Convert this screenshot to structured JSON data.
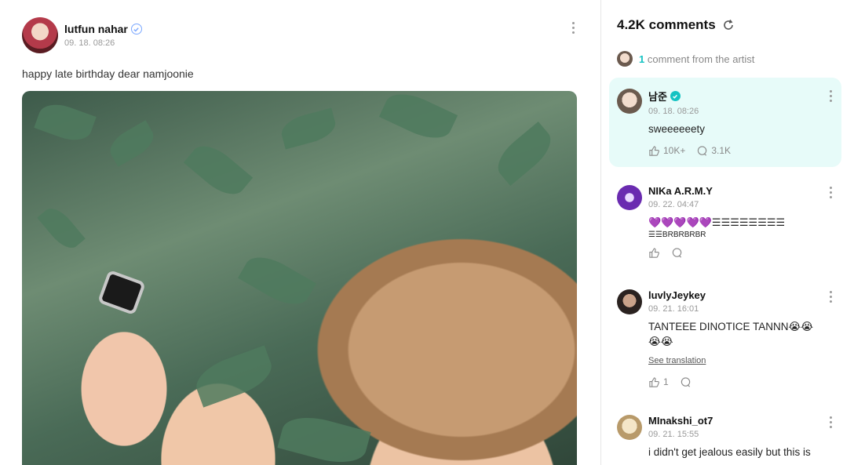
{
  "post": {
    "author": "lutfun nahar",
    "timestamp": "09. 18. 08:26",
    "text": "happy late birthday dear namjoonie"
  },
  "comments_panel": {
    "count_label": "4.2K comments",
    "artist_count": "1",
    "artist_label": "comment from the artist",
    "items": [
      {
        "name": "남준",
        "time": "09. 18. 08:26",
        "text": "sweeeeeety",
        "likes": "10K+",
        "replies": "3.1K"
      },
      {
        "name": "NIKa A.R.M.Y",
        "time": "09. 22. 04:47",
        "text_line1": "💜💜💜💜💜☰☰☰☰☰☰☰☰",
        "text_line2": "☰☰BRBRBRBR",
        "likes": "",
        "replies": ""
      },
      {
        "name": "luvlyJeykey",
        "time": "09. 21. 16:01",
        "text": "TANTEEE DINOTICE TANNN😭😭 😭😭",
        "see_translation": "See translation",
        "likes": "1",
        "replies": ""
      },
      {
        "name": "MInakshi_ot7",
        "time": "09. 21. 15:55",
        "text": "i didn't get jealous easily but this is"
      }
    ]
  },
  "colors": {
    "accent": "#16c3c3",
    "artist_bg": "#e7fbf9",
    "verified": "#7aa7ff"
  },
  "icons": [
    "verified-icon",
    "more-icon",
    "refresh-icon",
    "like-icon",
    "reply-icon"
  ]
}
